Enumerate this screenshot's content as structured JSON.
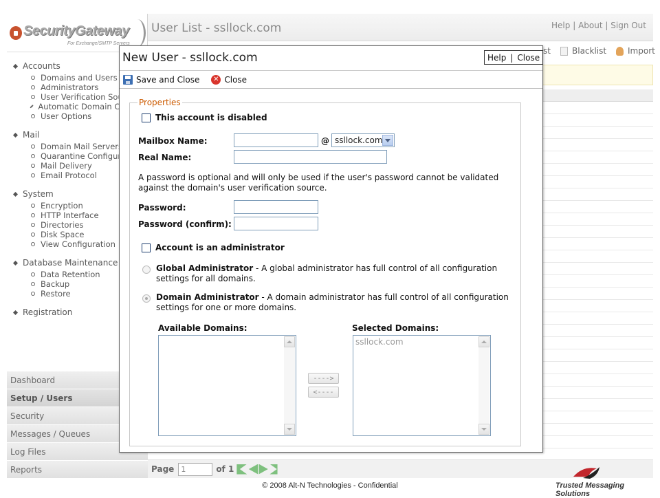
{
  "logo": {
    "text": "SecurityGateway",
    "subtitle": "For Exchange/SMTP Servers"
  },
  "sidebar": {
    "sections": [
      {
        "label": "Accounts",
        "items": [
          "Domains and Users",
          "Administrators",
          "User Verification Sources",
          "Automatic Domain Creation",
          "User Options"
        ]
      },
      {
        "label": "Mail",
        "items": [
          "Domain Mail Servers",
          "Quarantine Configuration",
          "Mail Delivery",
          "Email Protocol"
        ]
      },
      {
        "label": "System",
        "items": [
          "Encryption",
          "HTTP Interface",
          "Directories",
          "Disk Space",
          "View Configuration"
        ]
      },
      {
        "label": "Database Maintenance",
        "items": [
          "Data Retention",
          "Backup",
          "Restore"
        ]
      },
      {
        "label": "Registration",
        "items": []
      }
    ],
    "bottom_nav": [
      {
        "label": "Dashboard",
        "active": false
      },
      {
        "label": "Setup / Users",
        "active": true
      },
      {
        "label": "Security",
        "active": false
      },
      {
        "label": "Messages / Queues",
        "active": false
      },
      {
        "label": "Log Files",
        "active": false
      },
      {
        "label": "Reports",
        "active": false
      }
    ]
  },
  "main": {
    "title": "User List - ssllock.com",
    "top_links": {
      "help": "Help",
      "about": "About",
      "signout": "Sign Out",
      "sep": "|"
    },
    "toolbar": {
      "partial": "st",
      "blacklist": "Blacklist",
      "import": "Import"
    },
    "pager": {
      "label": "Page",
      "value": "1",
      "of": "of 1"
    }
  },
  "dialog": {
    "title": "New User - ssllock.com",
    "help": "Help",
    "close_link": "Close",
    "sep": "|",
    "toolbar": {
      "save_close": "Save and Close",
      "close": "Close"
    },
    "fieldset_legend": "Properties",
    "disabled_label": "This account is disabled",
    "mailbox_label": "Mailbox Name:",
    "mailbox_value": "",
    "at_sign": "@",
    "domain_selected": "ssllock.com",
    "realname_label": "Real Name:",
    "realname_value": "",
    "password_note": "A password is optional and will only be used if the user's password cannot be validated against the domain's user verification source.",
    "password_label": "Password:",
    "password_confirm_label": "Password (confirm):",
    "admin_label": "Account is an administrator",
    "global_admin_title": "Global Administrator",
    "global_admin_desc": " - A global administrator has full control of all configuration settings for all domains.",
    "domain_admin_title": "Domain Administrator",
    "domain_admin_desc": " - A domain administrator has full control of all configuration settings for one or more domains.",
    "available_label": "Available Domains:",
    "selected_label": "Selected Domains:",
    "available_domains": [],
    "selected_domains": [
      "ssllock.com"
    ],
    "add_button": "---->",
    "remove_button": "<----"
  },
  "footer": {
    "copyright": "© 2008 Alt-N Technologies - Confidential",
    "brand": "Trusted Messaging Solutions"
  },
  "colors": {
    "legend": "#cc5a00",
    "checkbox_border": "#1c3d6e",
    "field_border": "#7f9db9",
    "notice_bg": "#fefbe6"
  }
}
